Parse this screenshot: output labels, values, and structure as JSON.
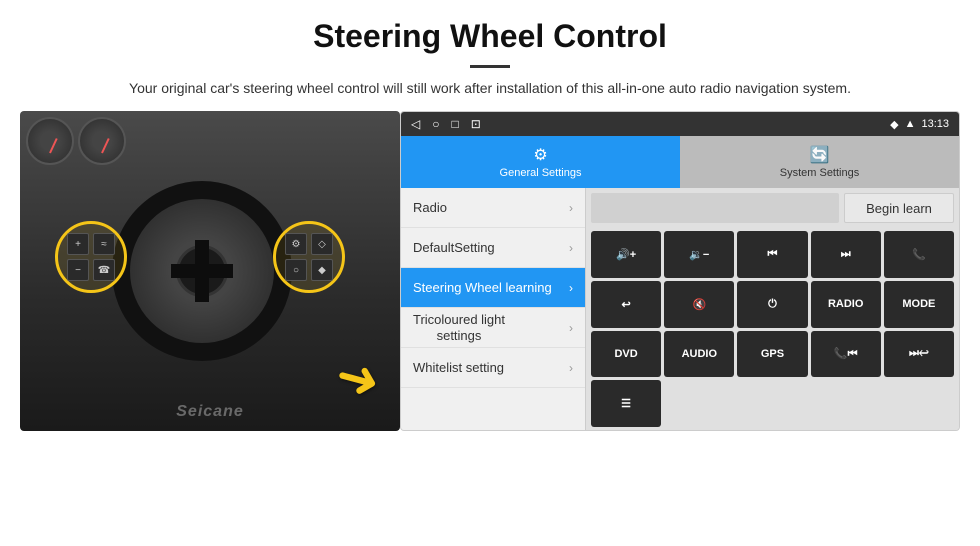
{
  "header": {
    "title": "Steering Wheel Control",
    "subtitle": "Your original car's steering wheel control will still work after installation of this all-in-one auto radio navigation system."
  },
  "status_bar": {
    "nav_icons": [
      "◁",
      "○",
      "□",
      "⊡"
    ],
    "right_icons": [
      "♦",
      "▲"
    ],
    "time": "13:13"
  },
  "tabs": [
    {
      "id": "general",
      "label": "General Settings",
      "icon": "⚙",
      "active": true
    },
    {
      "id": "system",
      "label": "System Settings",
      "icon": "🔄",
      "active": false
    }
  ],
  "menu_items": [
    {
      "label": "Radio",
      "active": false
    },
    {
      "label": "DefaultSetting",
      "active": false
    },
    {
      "label": "Steering Wheel learning",
      "active": true
    },
    {
      "label": "Tricoloured light settings",
      "active": false
    },
    {
      "label": "Whitelist setting",
      "active": false
    }
  ],
  "control_panel": {
    "begin_learn_label": "Begin learn",
    "buttons_row1": [
      "vol+",
      "vol-",
      "prev",
      "next",
      "phone"
    ],
    "buttons_row2": [
      "hang",
      "mute",
      "power",
      "RADIO",
      "MODE"
    ],
    "buttons_row3": [
      "DVD",
      "AUDIO",
      "GPS",
      "phone2",
      "skip"
    ],
    "buttons_row4": [
      "menu"
    ]
  },
  "watermark": "Seicane"
}
